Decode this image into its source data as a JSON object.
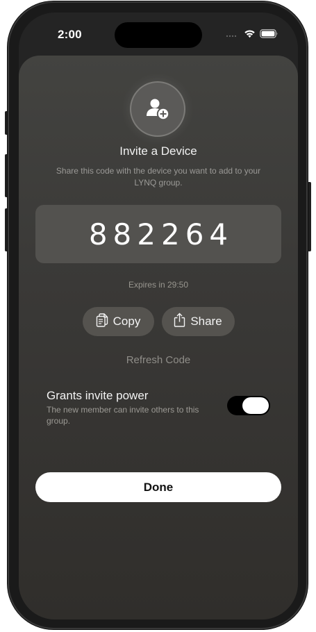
{
  "status_bar": {
    "time": "2:00"
  },
  "icons": {
    "header": "add-user-icon",
    "copy": "copy-icon",
    "share": "share-icon",
    "wifi": "wifi-icon",
    "battery": "battery-icon"
  },
  "invite": {
    "title": "Invite a Device",
    "subtitle": "Share this code with the device you want to add to your LYNQ group.",
    "code": "882264",
    "expires": "Expires in 29:50"
  },
  "actions": {
    "copy_label": "Copy",
    "share_label": "Share",
    "refresh_label": "Refresh Code"
  },
  "permission": {
    "title": "Grants invite power",
    "description": "The new member can invite others to this group.",
    "enabled": true
  },
  "footer": {
    "done_label": "Done"
  },
  "colors": {
    "sheet_top": "#434340",
    "sheet_bottom": "#302e2b",
    "pill_bg": "#55534f",
    "toggle_track": "#000000"
  }
}
